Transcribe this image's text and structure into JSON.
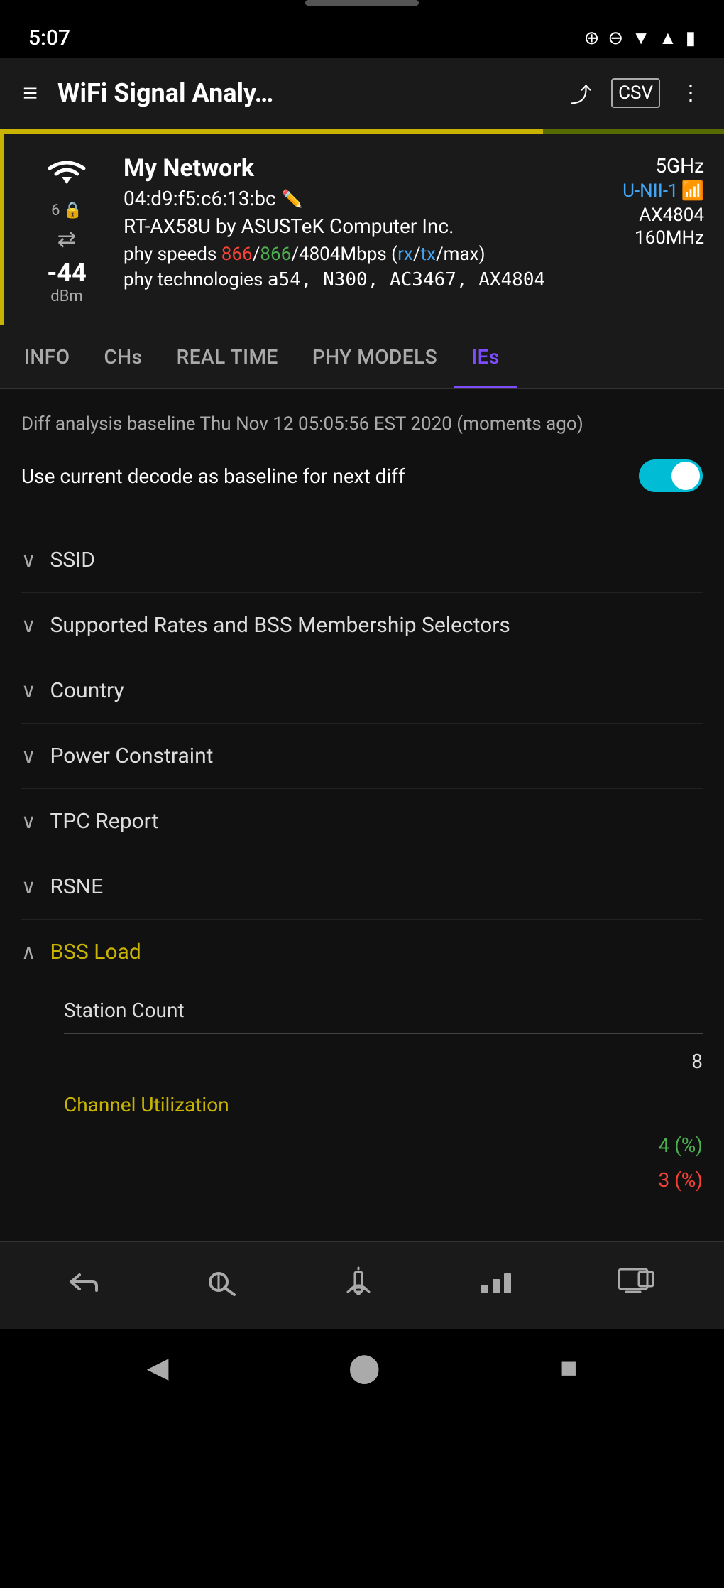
{
  "statusBar": {
    "time": "5:07",
    "rightIcons": [
      "⊕",
      "⊖",
      "▼",
      "▲",
      "🔋"
    ]
  },
  "topBar": {
    "title": "WiFi Signal Analy…",
    "menuIcon": "≡",
    "shareIcon": "⤴",
    "csvIcon": "CSV",
    "moreIcon": "⋮"
  },
  "networkCard": {
    "name": "My Network",
    "mac": "04:d9:f5:c6:13:bc",
    "router": "RT-AX58U by ASUSTeK Computer Inc.",
    "phySpeeds": "phy speeds 866/866/4804Mbps (rx/tx/max)",
    "phySpeedRx": "866",
    "phySpeedTx": "866",
    "phySpeedMax": "4804Mbps",
    "phyTech": "phy technologies a54, N300, AC3467, AX4804",
    "signal": "-44",
    "signalUnit": "dBm",
    "frequency": "5GHz",
    "channel": "U-NII-1",
    "standard": "AX4804",
    "bandwidth": "160MHz"
  },
  "tabs": [
    {
      "label": "INFO",
      "active": false
    },
    {
      "label": "CHs",
      "active": false
    },
    {
      "label": "REAL TIME",
      "active": false
    },
    {
      "label": "PHY MODELS",
      "active": false
    },
    {
      "label": "IEs",
      "active": true
    }
  ],
  "content": {
    "diffBaseline": "Diff analysis baseline Thu Nov 12 05:05:56 EST 2020\n(moments ago)",
    "toggleLabel": "Use current decode as baseline for next diff",
    "toggleOn": true
  },
  "ieItems": [
    {
      "label": "SSID",
      "expanded": false,
      "yellow": false
    },
    {
      "label": "Supported Rates and BSS Membership Selectors",
      "expanded": false,
      "yellow": false
    },
    {
      "label": "Country",
      "expanded": false,
      "yellow": false
    },
    {
      "label": "Power Constraint",
      "expanded": false,
      "yellow": false
    },
    {
      "label": "TPC Report",
      "expanded": false,
      "yellow": false
    },
    {
      "label": "RSNE",
      "expanded": false,
      "yellow": false
    },
    {
      "label": "BSS Load",
      "expanded": true,
      "yellow": true
    }
  ],
  "bssLoad": {
    "stationCountLabel": "Station Count",
    "stationCountValue": "8",
    "channelUtilizationLabel": "Channel Utilization",
    "channelUtilizationValue1": "4 (%)",
    "channelUtilizationValue2": "3 (%)"
  },
  "bottomNav": [
    {
      "icon": "↺",
      "label": ""
    },
    {
      "icon": "◎",
      "label": ""
    },
    {
      "icon": "📡",
      "label": ""
    },
    {
      "icon": "📊",
      "label": ""
    },
    {
      "icon": "⬜",
      "label": ""
    }
  ],
  "androidNav": {
    "back": "◀",
    "home": "⬤",
    "recent": "■"
  }
}
